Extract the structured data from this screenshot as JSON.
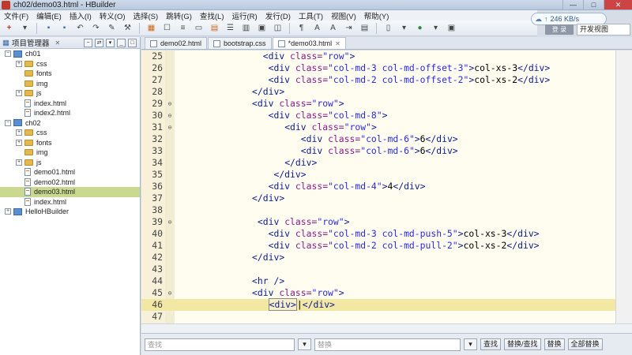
{
  "window": {
    "title": "ch02/demo03.html - HBuilder",
    "controls": [
      "—",
      "□",
      "✕"
    ]
  },
  "menu": [
    "文件(F)",
    "编辑(E)",
    "插入(I)",
    "转义(O)",
    "选择(S)",
    "跳转(G)",
    "查找(L)",
    "运行(R)",
    "发行(D)",
    "工具(T)",
    "视图(V)",
    "帮助(Y)"
  ],
  "network": {
    "speed": "246 KB/s"
  },
  "login_label": "登 录",
  "view_select": "开发视图",
  "project_panel": {
    "title": "项目管理器",
    "tree": [
      {
        "label": "ch01",
        "type": "project",
        "level": 0,
        "expander": "⊟"
      },
      {
        "label": "css",
        "type": "folder",
        "level": 1,
        "expander": "⊞"
      },
      {
        "label": "fonts",
        "type": "folder",
        "level": 1,
        "expander": ""
      },
      {
        "label": "img",
        "type": "folder",
        "level": 1,
        "expander": ""
      },
      {
        "label": "js",
        "type": "folder",
        "level": 1,
        "expander": "⊞"
      },
      {
        "label": "index.html",
        "type": "file",
        "level": 1,
        "expander": ""
      },
      {
        "label": "index2.html",
        "type": "file",
        "level": 1,
        "expander": ""
      },
      {
        "label": "ch02",
        "type": "project",
        "level": 0,
        "expander": "⊟"
      },
      {
        "label": "css",
        "type": "folder",
        "level": 1,
        "expander": "⊞"
      },
      {
        "label": "fonts",
        "type": "folder",
        "level": 1,
        "expander": "⊞"
      },
      {
        "label": "img",
        "type": "folder",
        "level": 1,
        "expander": ""
      },
      {
        "label": "js",
        "type": "folder",
        "level": 1,
        "expander": "⊞"
      },
      {
        "label": "demo01.html",
        "type": "file",
        "level": 1,
        "expander": ""
      },
      {
        "label": "demo02.html",
        "type": "file",
        "level": 1,
        "expander": ""
      },
      {
        "label": "demo03.html",
        "type": "file",
        "level": 1,
        "expander": "",
        "selected": true
      },
      {
        "label": "index.html",
        "type": "file",
        "level": 1,
        "expander": ""
      },
      {
        "label": "HelloHBuilder",
        "type": "project",
        "level": 0,
        "expander": "⊞"
      }
    ]
  },
  "tabs": [
    {
      "label": "demo02.html",
      "active": false
    },
    {
      "label": "bootstrap.css",
      "active": false
    },
    {
      "label": "*demo03.html",
      "active": true
    }
  ],
  "code_lines": [
    {
      "n": "25",
      "fold": "",
      "indent": 16,
      "tokens": [
        [
          "tag",
          "<div "
        ],
        [
          "attr",
          "class="
        ],
        [
          "val",
          "\"row\""
        ],
        [
          "tag",
          ">"
        ]
      ]
    },
    {
      "n": "26",
      "fold": "",
      "indent": 17,
      "tokens": [
        [
          "tag",
          "<div "
        ],
        [
          "attr",
          "class="
        ],
        [
          "val",
          "\"col-md-3 col-md-offset-3\""
        ],
        [
          "tag",
          ">"
        ],
        [
          "txt",
          "col-xs-3"
        ],
        [
          "tag",
          "</div>"
        ]
      ]
    },
    {
      "n": "27",
      "fold": "",
      "indent": 17,
      "tokens": [
        [
          "tag",
          "<div "
        ],
        [
          "attr",
          "class="
        ],
        [
          "val",
          "\"col-md-2 col-md-offset-2\""
        ],
        [
          "tag",
          ">"
        ],
        [
          "txt",
          "col-xs-2"
        ],
        [
          "tag",
          "</div>"
        ]
      ]
    },
    {
      "n": "28",
      "fold": "",
      "indent": 14,
      "tokens": [
        [
          "tag",
          "</div>"
        ]
      ]
    },
    {
      "n": "29",
      "fold": "⊖",
      "indent": 14,
      "tokens": [
        [
          "tag",
          "<div "
        ],
        [
          "attr",
          "class="
        ],
        [
          "val",
          "\"row\""
        ],
        [
          "tag",
          ">"
        ]
      ]
    },
    {
      "n": "30",
      "fold": "⊖",
      "indent": 17,
      "tokens": [
        [
          "tag",
          "<div "
        ],
        [
          "attr",
          "class="
        ],
        [
          "val",
          "\"col-md-8\""
        ],
        [
          "tag",
          ">"
        ]
      ]
    },
    {
      "n": "31",
      "fold": "⊖",
      "indent": 20,
      "tokens": [
        [
          "tag",
          "<div "
        ],
        [
          "attr",
          "class="
        ],
        [
          "val",
          "\"row\""
        ],
        [
          "tag",
          ">"
        ]
      ]
    },
    {
      "n": "32",
      "fold": "",
      "indent": 23,
      "tokens": [
        [
          "tag",
          "<div "
        ],
        [
          "attr",
          "class="
        ],
        [
          "val",
          "\"col-md-6\""
        ],
        [
          "tag",
          ">"
        ],
        [
          "txt",
          "6"
        ],
        [
          "tag",
          "</div>"
        ]
      ]
    },
    {
      "n": "33",
      "fold": "",
      "indent": 23,
      "tokens": [
        [
          "tag",
          "<div "
        ],
        [
          "attr",
          "class="
        ],
        [
          "val",
          "\"col-md-6\""
        ],
        [
          "tag",
          ">"
        ],
        [
          "txt",
          "6"
        ],
        [
          "tag",
          "</div>"
        ]
      ]
    },
    {
      "n": "34",
      "fold": "",
      "indent": 20,
      "tokens": [
        [
          "tag",
          "</div>"
        ]
      ]
    },
    {
      "n": "35",
      "fold": "",
      "indent": 18,
      "tokens": [
        [
          "tag",
          "</div>"
        ]
      ]
    },
    {
      "n": "36",
      "fold": "",
      "indent": 17,
      "tokens": [
        [
          "tag",
          "<div "
        ],
        [
          "attr",
          "class="
        ],
        [
          "val",
          "\"col-md-4\""
        ],
        [
          "tag",
          ">"
        ],
        [
          "txt",
          "4"
        ],
        [
          "tag",
          "</div>"
        ]
      ]
    },
    {
      "n": "37",
      "fold": "",
      "indent": 14,
      "tokens": [
        [
          "tag",
          "</div>"
        ]
      ]
    },
    {
      "n": "38",
      "fold": "",
      "indent": 0,
      "tokens": []
    },
    {
      "n": "39",
      "fold": "⊖",
      "indent": 15,
      "tokens": [
        [
          "tag",
          "<div "
        ],
        [
          "attr",
          "class="
        ],
        [
          "val",
          "\"row\""
        ],
        [
          "tag",
          ">"
        ]
      ]
    },
    {
      "n": "40",
      "fold": "",
      "indent": 17,
      "tokens": [
        [
          "tag",
          "<div "
        ],
        [
          "attr",
          "class="
        ],
        [
          "val",
          "\"col-md-3 col-md-push-5\""
        ],
        [
          "tag",
          ">"
        ],
        [
          "txt",
          "col-xs-3"
        ],
        [
          "tag",
          "</div>"
        ]
      ]
    },
    {
      "n": "41",
      "fold": "",
      "indent": 17,
      "tokens": [
        [
          "tag",
          "<div "
        ],
        [
          "attr",
          "class="
        ],
        [
          "val",
          "\"col-md-2 col-md-pull-2\""
        ],
        [
          "tag",
          ">"
        ],
        [
          "txt",
          "col-xs-2"
        ],
        [
          "tag",
          "</div>"
        ]
      ]
    },
    {
      "n": "42",
      "fold": "",
      "indent": 14,
      "tokens": [
        [
          "tag",
          "</div>"
        ]
      ]
    },
    {
      "n": "43",
      "fold": "",
      "indent": 0,
      "tokens": []
    },
    {
      "n": "44",
      "fold": "",
      "indent": 14,
      "tokens": [
        [
          "tag",
          "<hr />"
        ]
      ]
    },
    {
      "n": "45",
      "fold": "⊖",
      "indent": 14,
      "tokens": [
        [
          "tag",
          "<div "
        ],
        [
          "attr",
          "class="
        ],
        [
          "val",
          "\"row\""
        ],
        [
          "tag",
          ">"
        ]
      ]
    },
    {
      "n": "46",
      "fold": "",
      "indent": 17,
      "current": true,
      "tokens": [
        [
          "caret",
          "<div>"
        ],
        [
          "txt",
          "|"
        ],
        [
          "tag",
          "</div>"
        ]
      ]
    },
    {
      "n": "47",
      "fold": "",
      "indent": 0,
      "tokens": []
    }
  ],
  "find_bar": {
    "find_placeholder": "查找",
    "replace_placeholder": "替换",
    "buttons": [
      "查找",
      "替换/查找",
      "替换",
      "全部替换"
    ]
  }
}
